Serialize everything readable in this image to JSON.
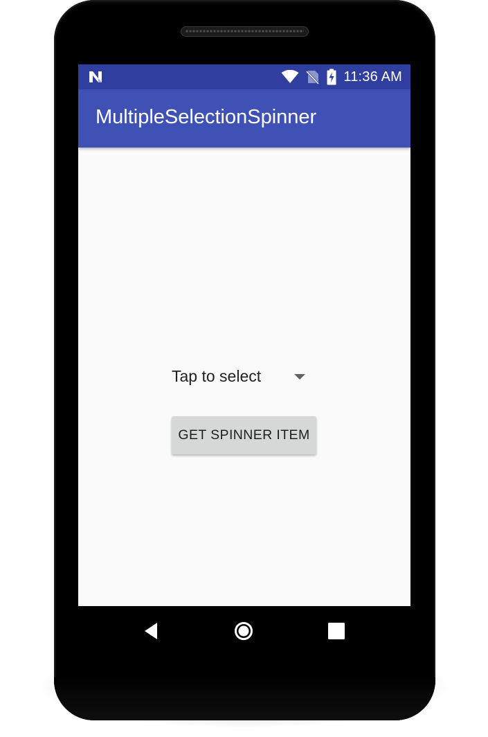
{
  "status_bar": {
    "notification_icon": "android-n-icon",
    "icons": [
      "wifi-icon",
      "no-sim-icon",
      "battery-charging-icon"
    ],
    "time": "11:36 AM",
    "background_color": "#303f9f"
  },
  "app_bar": {
    "title": "MultipleSelectionSpinner",
    "background_color": "#3f51b5"
  },
  "main": {
    "spinner": {
      "label": "Tap to select",
      "icon": "dropdown-arrow-icon"
    },
    "button": {
      "label": "GET SPINNER ITEM",
      "background_color": "#d6d7d7"
    }
  },
  "nav_bar": {
    "buttons": [
      "back-icon",
      "home-icon",
      "recents-icon"
    ]
  }
}
